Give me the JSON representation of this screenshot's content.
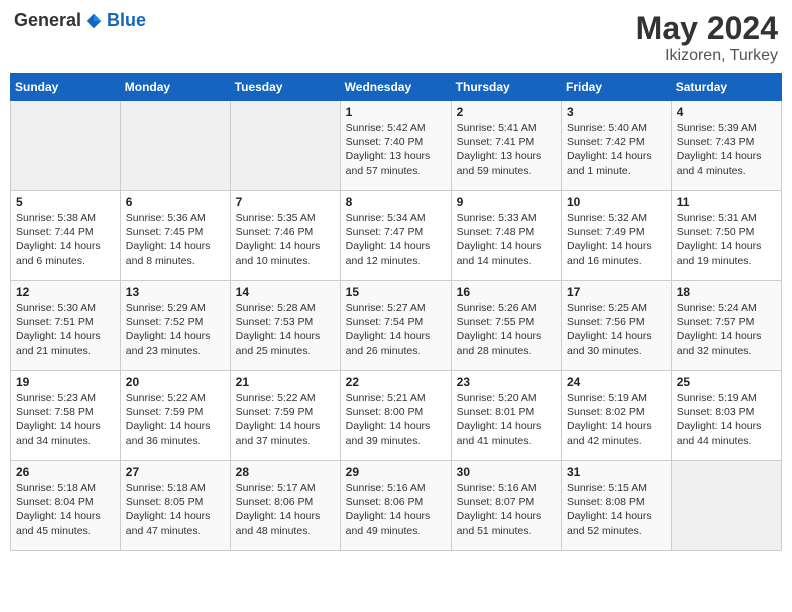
{
  "header": {
    "logo_general": "General",
    "logo_blue": "Blue",
    "month_year": "May 2024",
    "location": "Ikizoren, Turkey"
  },
  "weekdays": [
    "Sunday",
    "Monday",
    "Tuesday",
    "Wednesday",
    "Thursday",
    "Friday",
    "Saturday"
  ],
  "weeks": [
    [
      {
        "day": "",
        "content": ""
      },
      {
        "day": "",
        "content": ""
      },
      {
        "day": "",
        "content": ""
      },
      {
        "day": "1",
        "content": "Sunrise: 5:42 AM\nSunset: 7:40 PM\nDaylight: 13 hours and 57 minutes."
      },
      {
        "day": "2",
        "content": "Sunrise: 5:41 AM\nSunset: 7:41 PM\nDaylight: 13 hours and 59 minutes."
      },
      {
        "day": "3",
        "content": "Sunrise: 5:40 AM\nSunset: 7:42 PM\nDaylight: 14 hours and 1 minute."
      },
      {
        "day": "4",
        "content": "Sunrise: 5:39 AM\nSunset: 7:43 PM\nDaylight: 14 hours and 4 minutes."
      }
    ],
    [
      {
        "day": "5",
        "content": "Sunrise: 5:38 AM\nSunset: 7:44 PM\nDaylight: 14 hours and 6 minutes."
      },
      {
        "day": "6",
        "content": "Sunrise: 5:36 AM\nSunset: 7:45 PM\nDaylight: 14 hours and 8 minutes."
      },
      {
        "day": "7",
        "content": "Sunrise: 5:35 AM\nSunset: 7:46 PM\nDaylight: 14 hours and 10 minutes."
      },
      {
        "day": "8",
        "content": "Sunrise: 5:34 AM\nSunset: 7:47 PM\nDaylight: 14 hours and 12 minutes."
      },
      {
        "day": "9",
        "content": "Sunrise: 5:33 AM\nSunset: 7:48 PM\nDaylight: 14 hours and 14 minutes."
      },
      {
        "day": "10",
        "content": "Sunrise: 5:32 AM\nSunset: 7:49 PM\nDaylight: 14 hours and 16 minutes."
      },
      {
        "day": "11",
        "content": "Sunrise: 5:31 AM\nSunset: 7:50 PM\nDaylight: 14 hours and 19 minutes."
      }
    ],
    [
      {
        "day": "12",
        "content": "Sunrise: 5:30 AM\nSunset: 7:51 PM\nDaylight: 14 hours and 21 minutes."
      },
      {
        "day": "13",
        "content": "Sunrise: 5:29 AM\nSunset: 7:52 PM\nDaylight: 14 hours and 23 minutes."
      },
      {
        "day": "14",
        "content": "Sunrise: 5:28 AM\nSunset: 7:53 PM\nDaylight: 14 hours and 25 minutes."
      },
      {
        "day": "15",
        "content": "Sunrise: 5:27 AM\nSunset: 7:54 PM\nDaylight: 14 hours and 26 minutes."
      },
      {
        "day": "16",
        "content": "Sunrise: 5:26 AM\nSunset: 7:55 PM\nDaylight: 14 hours and 28 minutes."
      },
      {
        "day": "17",
        "content": "Sunrise: 5:25 AM\nSunset: 7:56 PM\nDaylight: 14 hours and 30 minutes."
      },
      {
        "day": "18",
        "content": "Sunrise: 5:24 AM\nSunset: 7:57 PM\nDaylight: 14 hours and 32 minutes."
      }
    ],
    [
      {
        "day": "19",
        "content": "Sunrise: 5:23 AM\nSunset: 7:58 PM\nDaylight: 14 hours and 34 minutes."
      },
      {
        "day": "20",
        "content": "Sunrise: 5:22 AM\nSunset: 7:59 PM\nDaylight: 14 hours and 36 minutes."
      },
      {
        "day": "21",
        "content": "Sunrise: 5:22 AM\nSunset: 7:59 PM\nDaylight: 14 hours and 37 minutes."
      },
      {
        "day": "22",
        "content": "Sunrise: 5:21 AM\nSunset: 8:00 PM\nDaylight: 14 hours and 39 minutes."
      },
      {
        "day": "23",
        "content": "Sunrise: 5:20 AM\nSunset: 8:01 PM\nDaylight: 14 hours and 41 minutes."
      },
      {
        "day": "24",
        "content": "Sunrise: 5:19 AM\nSunset: 8:02 PM\nDaylight: 14 hours and 42 minutes."
      },
      {
        "day": "25",
        "content": "Sunrise: 5:19 AM\nSunset: 8:03 PM\nDaylight: 14 hours and 44 minutes."
      }
    ],
    [
      {
        "day": "26",
        "content": "Sunrise: 5:18 AM\nSunset: 8:04 PM\nDaylight: 14 hours and 45 minutes."
      },
      {
        "day": "27",
        "content": "Sunrise: 5:18 AM\nSunset: 8:05 PM\nDaylight: 14 hours and 47 minutes."
      },
      {
        "day": "28",
        "content": "Sunrise: 5:17 AM\nSunset: 8:06 PM\nDaylight: 14 hours and 48 minutes."
      },
      {
        "day": "29",
        "content": "Sunrise: 5:16 AM\nSunset: 8:06 PM\nDaylight: 14 hours and 49 minutes."
      },
      {
        "day": "30",
        "content": "Sunrise: 5:16 AM\nSunset: 8:07 PM\nDaylight: 14 hours and 51 minutes."
      },
      {
        "day": "31",
        "content": "Sunrise: 5:15 AM\nSunset: 8:08 PM\nDaylight: 14 hours and 52 minutes."
      },
      {
        "day": "",
        "content": ""
      }
    ]
  ]
}
